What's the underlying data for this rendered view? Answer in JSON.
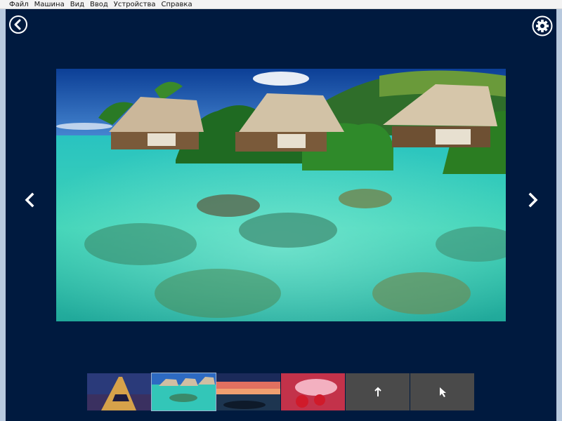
{
  "menu": {
    "items": [
      "Файл",
      "Машина",
      "Вид",
      "Ввод",
      "Устройства",
      "Справка"
    ]
  },
  "toolbar": {
    "back_icon": "back-arrow-icon",
    "settings_icon": "gear-icon"
  },
  "viewer": {
    "prev_icon": "chevron-left-icon",
    "next_icon": "chevron-right-icon",
    "main_image": "tropical-lagoon-overwater-bungalows"
  },
  "thumbnails": [
    {
      "subject": "eiffel-tower-night",
      "selected": false
    },
    {
      "subject": "tropical-lagoon-overwater-bungalows",
      "selected": true
    },
    {
      "subject": "sunset-rocky-coast",
      "selected": false
    },
    {
      "subject": "strawberries-splash",
      "selected": false
    },
    {
      "subject": "up-arrow-icon",
      "selected": false
    },
    {
      "subject": "pointer-icon",
      "selected": false
    }
  ],
  "colors": {
    "background": "#001a3f",
    "icon": "#ffffff",
    "action_tile": "#4a4a4a"
  }
}
